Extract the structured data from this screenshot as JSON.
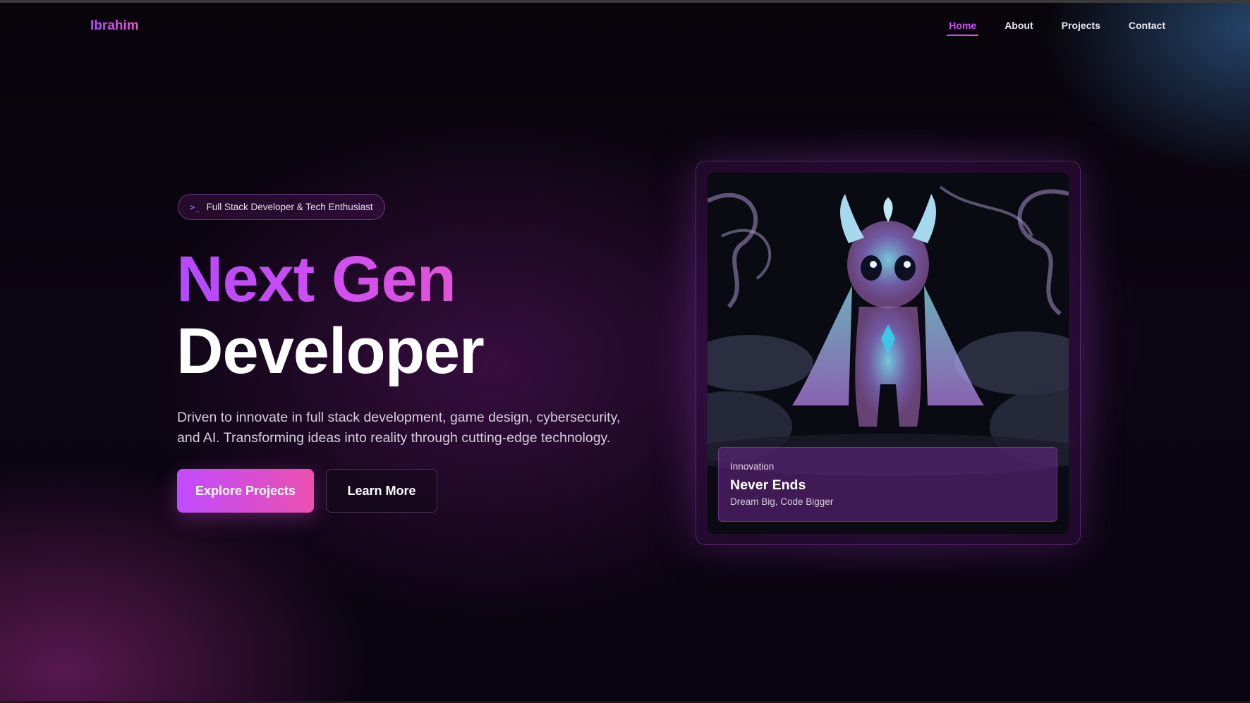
{
  "brand": "Ibrahim",
  "nav": {
    "items": [
      {
        "label": "Home",
        "active": true
      },
      {
        "label": "About",
        "active": false
      },
      {
        "label": "Projects",
        "active": false
      },
      {
        "label": "Contact",
        "active": false
      }
    ]
  },
  "hero": {
    "tagline": {
      "icon": "terminal-icon",
      "text": "Full Stack Developer & Tech Enthusiast"
    },
    "title_line1": "Next Gen",
    "title_line2": "Developer",
    "description": "Driven to innovate in full stack development, game design, cybersecurity, and AI. Transforming ideas into reality through cutting-edge technology.",
    "primary_button": "Explore Projects",
    "secondary_button": "Learn More"
  },
  "card": {
    "image": "glowing-creature-illustration",
    "caption": {
      "kicker": "Innovation",
      "title": "Never Ends",
      "subtitle": "Dream Big, Code Bigger"
    }
  },
  "colors": {
    "accent_purple": "#b94bff",
    "accent_pink": "#ec4fae",
    "background": "#060309"
  }
}
